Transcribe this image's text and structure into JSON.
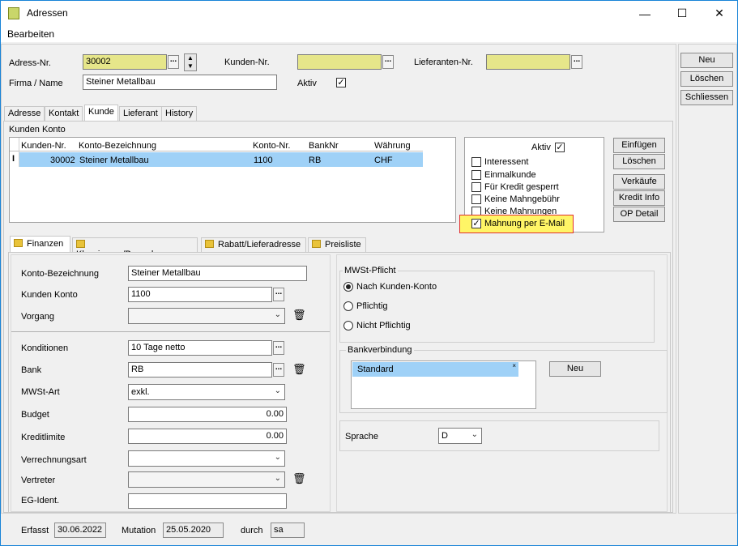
{
  "window": {
    "title": "Adressen",
    "menu": "Bearbeiten"
  },
  "header": {
    "adress_nr_label": "Adress-Nr.",
    "adress_nr": "30002",
    "kunden_nr_label": "Kunden-Nr.",
    "kunden_nr": "",
    "lieferanten_nr_label": "Lieferanten-Nr.",
    "lieferanten_nr": "",
    "firma_label": "Firma / Name",
    "firma": "Steiner Metallbau",
    "aktiv_label": "Aktiv"
  },
  "side_buttons": {
    "neu": "Neu",
    "loeschen": "Löschen",
    "schliessen": "Schliessen"
  },
  "tabs": [
    "Adresse",
    "Kontakt",
    "Kunde",
    "Lieferant",
    "History"
  ],
  "kunden_konto": {
    "title": "Kunden Konto",
    "columns": [
      "Kunden-Nr.",
      "Konto-Bezeichnung",
      "Konto-Nr.",
      "BankNr",
      "Währung"
    ],
    "row": [
      "30002",
      "Steiner Metallbau",
      "1100",
      "RB",
      "CHF"
    ]
  },
  "flags": {
    "aktiv": "Aktiv",
    "items": [
      "Interessent",
      "Einmalkunde",
      "Für Kredit gesperrt",
      "Keine Mahngebühr",
      "Keine Mahnungen",
      "Mahnung per E-Mail"
    ]
  },
  "right_buttons": {
    "einfuegen": "Einfügen",
    "loeschen": "Löschen",
    "verkaeufe": "Verkäufe",
    "kredit": "Kredit Info",
    "op": "OP Detail"
  },
  "subtabs": [
    "Finanzen",
    "Klassierung/Bemerkungen",
    "Rabatt/Lieferadresse",
    "Preisliste"
  ],
  "finanzen": {
    "konto_bez_label": "Konto-Bezeichnung",
    "konto_bez": "Steiner Metallbau",
    "kunden_konto_label": "Kunden Konto",
    "kunden_konto": "1100",
    "vorgang_label": "Vorgang",
    "vorgang": "",
    "konditionen_label": "Konditionen",
    "konditionen": "10 Tage netto",
    "bank_label": "Bank",
    "bank": "RB",
    "mwst_art_label": "MWSt-Art",
    "mwst_art": "exkl.",
    "budget_label": "Budget",
    "budget": "0.00",
    "kreditlimite_label": "Kreditlimite",
    "kreditlimite": "0.00",
    "verrechnungsart_label": "Verrechnungsart",
    "verrechnungsart": "",
    "vertreter_label": "Vertreter",
    "vertreter": "",
    "eg_label": "EG-Ident.",
    "eg": ""
  },
  "mwst": {
    "title": "MWSt-Pflicht",
    "options": [
      "Nach Kunden-Konto",
      "Pflichtig",
      "Nicht Pflichtig"
    ]
  },
  "bank": {
    "title": "Bankverbindung",
    "item": "Standard",
    "neu": "Neu"
  },
  "sprache": {
    "label": "Sprache",
    "value": "D"
  },
  "footer": {
    "erfasst_label": "Erfasst",
    "erfasst": "30.06.2022",
    "mutation_label": "Mutation",
    "mutation": "25.05.2020",
    "durch_label": "durch",
    "durch": "sa"
  }
}
